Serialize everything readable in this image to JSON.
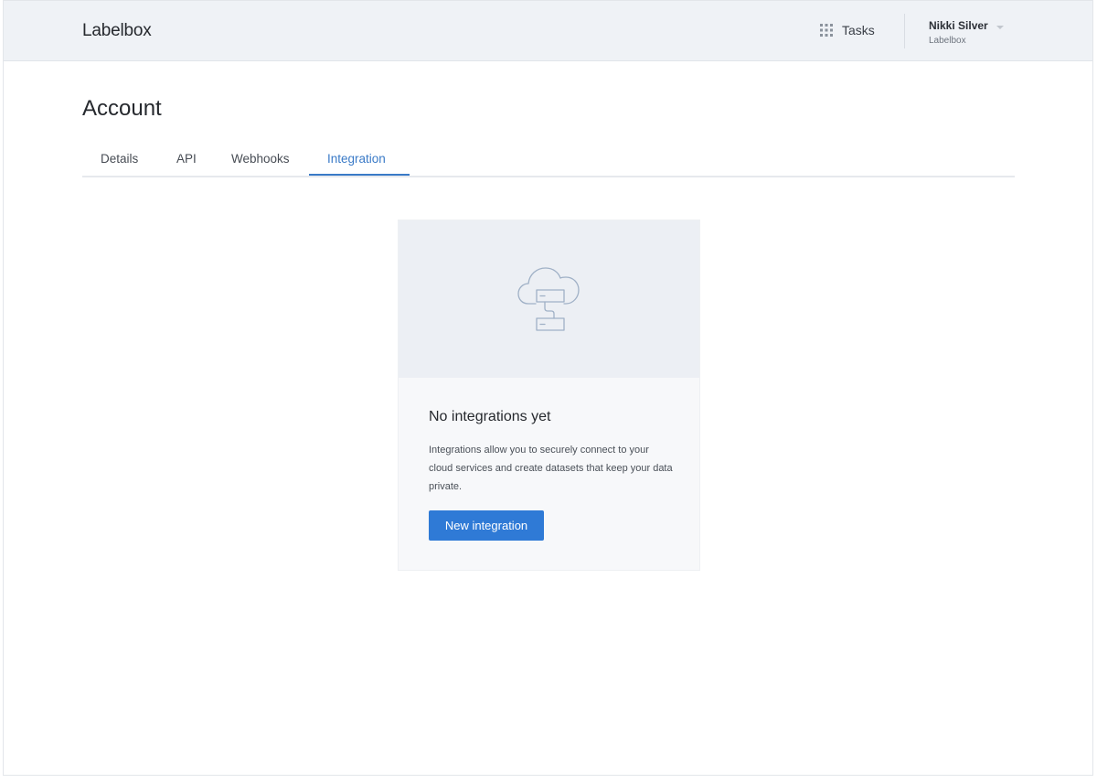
{
  "header": {
    "logo": "Labelbox",
    "tasks_label": "Tasks",
    "tasks_icon": "grid-icon",
    "user_name": "Nikki Silver",
    "user_org": "Labelbox"
  },
  "page": {
    "title": "Account"
  },
  "tabs": [
    {
      "label": "Details",
      "active": false
    },
    {
      "label": "API",
      "active": false
    },
    {
      "label": "Webhooks",
      "active": false
    },
    {
      "label": "Integration",
      "active": true
    }
  ],
  "empty_state": {
    "icon": "cloud-server-icon",
    "title": "No integrations yet",
    "description": "Integrations allow you to securely connect to your cloud services and create datasets that keep your data private.",
    "button_label": "New integration"
  },
  "colors": {
    "accent": "#2f7ad6",
    "active_tab": "#3a7ac7",
    "header_bg": "#eff2f6"
  }
}
